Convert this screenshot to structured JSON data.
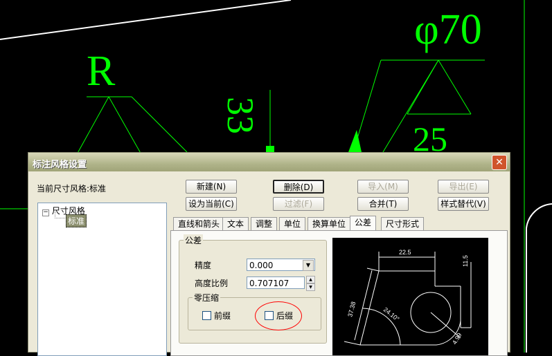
{
  "cad": {
    "labels": [
      "R",
      "33",
      "φ70",
      "25"
    ]
  },
  "dialog": {
    "title": "标注风格设置",
    "current_style_label": "当前尺寸风格:标准",
    "buttons": {
      "new": "新建(N)",
      "delete": "删除(D)",
      "import": "导入(M)",
      "export": "导出(E)",
      "set_current": "设为当前(C)",
      "filter": "过滤(F)",
      "merge": "合并(T)",
      "override": "样式替代(V)"
    },
    "tree": {
      "root": "尺寸风格",
      "child": "标准"
    },
    "tabs": [
      "直线和箭头",
      "文本",
      "调整",
      "单位",
      "换算单位",
      "公差",
      "尺寸形式"
    ],
    "active_tab": "公差",
    "tolerance": {
      "group": "公差",
      "precision_label": "精度",
      "precision_value": "0.000",
      "height_scale_label": "高度比例",
      "height_scale_value": "0.707107",
      "zero_group": "零压缩",
      "leading": "前缀",
      "trailing": "后缀",
      "leading_checked": false,
      "trailing_checked": false
    },
    "preview": {
      "labels": [
        "22.5",
        "11.5",
        "37.38",
        "24.10°",
        "4.99"
      ]
    }
  }
}
